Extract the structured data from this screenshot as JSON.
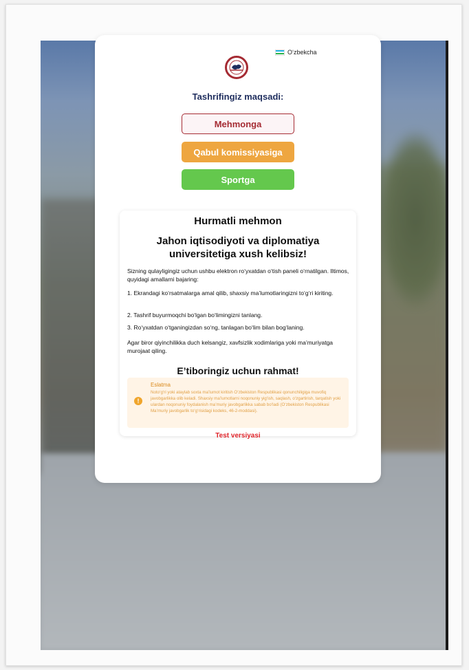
{
  "language": {
    "label": "O‘zbekcha",
    "flag_colors": [
      "#1eb4e6",
      "#ffffff",
      "#2fb44a"
    ]
  },
  "logo": {
    "name": "university-logo-icon"
  },
  "purpose_title": "Tashrifingiz maqsadi:",
  "buttons": {
    "guest": "Mehmonga",
    "admission": "Qabul komissiyasiga",
    "sport": "Sportga"
  },
  "info": {
    "greeting": "Hurmatli mehmon",
    "welcome_line1": "Jahon iqtisodiyoti va diplomatiya",
    "welcome_line2": "universitetiga xush kelibsiz!",
    "intro": "Sizning qulayligingiz uchun ushbu elektron ro‘yxatdan o‘tish paneli o‘rnatilgan. Iltimos, quyidagi amallarni bajaring:",
    "steps": [
      "1. Ekrandagi ko‘rsatmalarga amal qilib, shaxsiy ma’lumotlaringizni to‘g‘ri kiriting.",
      "2. Tashrif buyurmoqchi bo‘lgan bo‘limingizni tanlang.",
      "3. Ro‘yxatdan o‘tganingizdan so‘ng, tanlagan bo‘lim bilan bog‘laning."
    ],
    "help": "Agar biror qiyinchilikka duch kelsangiz, xavfsizlik xodimlariga yoki ma’muriyatga murojaat qiling.",
    "thanks": "E’tiboringiz uchun rahmat!",
    "notice_title": "Eslatma",
    "notice_body": "Noto‘g‘ri yoki ataylab soxta ma’lumot kiritish O‘zbekiston Respublikasi qonunchiligiga muvofiq javobgarlikka olib keladi. Shaxsiy ma’lumotlarni noqonuniy yig‘ish, saqlash, o‘zgartirish, tarqatish yoki ulardan noqonuniy foydalanish ma’muriy javobgarlikka sabab bo‘ladi (O‘zbekiston Respublikasi Ma’muriy javobgarlik to‘g‘risidagi kodeks, 46-2-moddasi).",
    "notice_icon": "!"
  },
  "test_version": "Test versiyasi",
  "colors": {
    "brand_red": "#a52b33",
    "admission_orange": "#eea640",
    "sport_green": "#64c84d",
    "title_navy": "#1f2e5e",
    "test_red": "#e0262c"
  }
}
